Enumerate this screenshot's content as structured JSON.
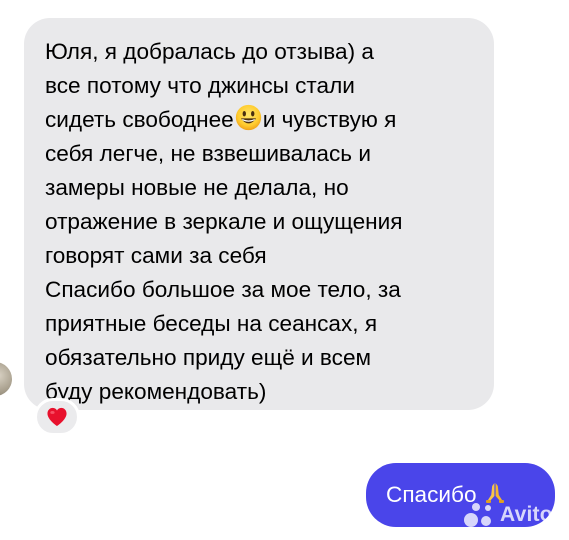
{
  "incoming_message": {
    "paragraphs": [
      {
        "before_emoji": "Юля, я добралась до отзыва) а\nвсе потому что джинсы стали\nсидеть свободнее",
        "emoji": "grinning-face-emoji",
        "after_emoji": "и чувствую я\nсебя легче, не взвешивалась и\nзамеры новые не делала, но\nотражение в зеркале и ощущения\nговорят сами за себя"
      },
      {
        "text": "Спасибо большое за мое тело, за\nприятные беседы на сеансах, я\nобязательно приду ещё и всем\nбуду рекомендовать)"
      }
    ],
    "reaction": "red-heart-icon",
    "bubble_color": "#e9e9eb"
  },
  "outgoing_message": {
    "text": "Спасибо",
    "emoji": "folded-hands-emoji",
    "bubble_color": "#4a45ea"
  },
  "watermark": {
    "text": "Avito",
    "icon": "avito-logo-icon"
  }
}
